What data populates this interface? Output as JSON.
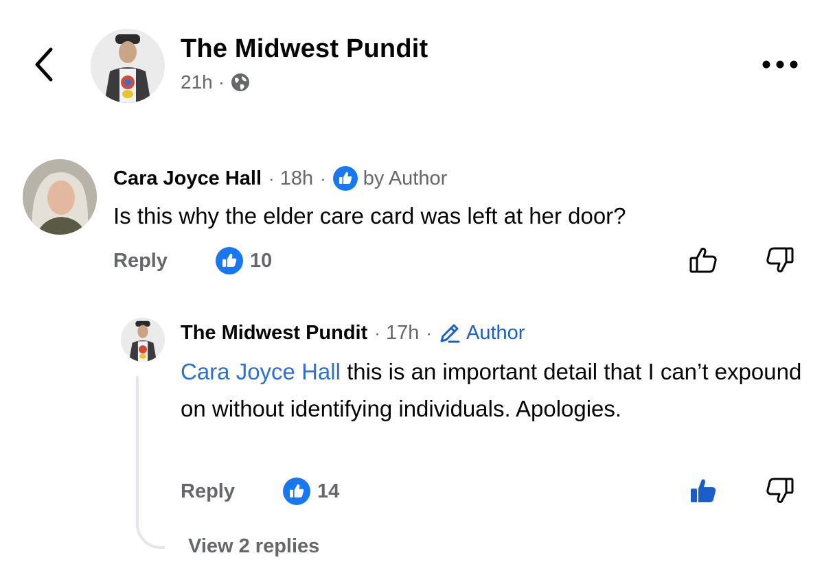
{
  "post": {
    "page_name": "The Midwest Pundit",
    "time": "21h",
    "separator": "·",
    "privacy_icon": "globe-icon"
  },
  "colors": {
    "primary_blue": "#1877f2",
    "link_blue": "#2e6fd2",
    "meta_gray": "#65676b",
    "text": "#050505",
    "thread_line": "#e4e6eb"
  },
  "comments": [
    {
      "author": "Cara Joyce Hall",
      "time": "18h",
      "badge_icon": "like-badge-icon",
      "badge_text": "by Author",
      "text": "Is this why the elder care card was left at her door?",
      "reply_label": "Reply",
      "reaction_count": "10",
      "liked": false
    }
  ],
  "replies": [
    {
      "author": "The Midwest Pundit",
      "time": "17h",
      "badge_icon": "pencil-icon",
      "badge_text": "Author",
      "mention": "Cara Joyce Hall",
      "text": " this is an important detail that I can’t expound on without identifying individuals. Apologies.",
      "reply_label": "Reply",
      "reaction_count": "14",
      "liked": true
    }
  ],
  "view_replies_label": "View 2 replies"
}
